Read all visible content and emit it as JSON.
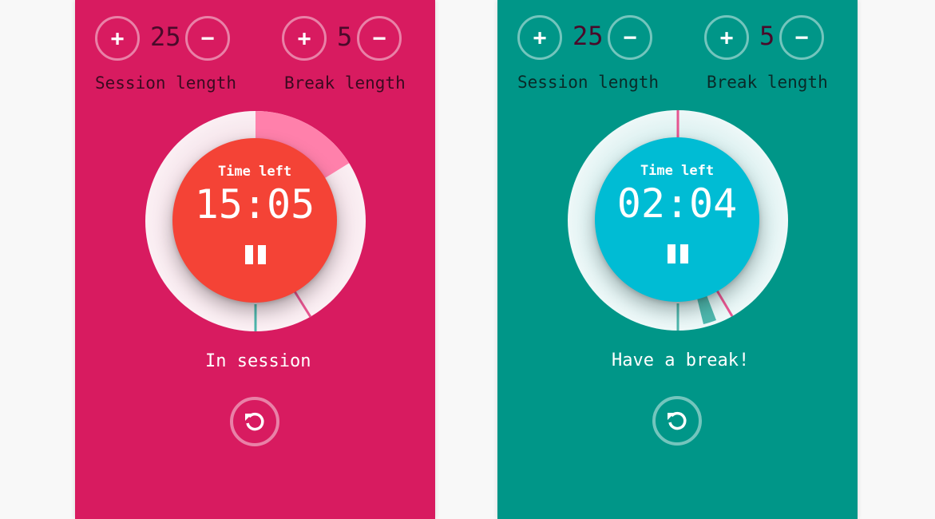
{
  "colors": {
    "session_panel_bg": "#d81b60",
    "break_panel_bg": "#009688",
    "session_inner": "#f44336",
    "break_inner": "#00bcd4",
    "progress_pink": "#ff80ab",
    "value_text": "#4a0025"
  },
  "icons": {
    "increase": "plus-icon",
    "decrease": "minus-icon",
    "pause": "pause-icon",
    "reset": "reset-icon"
  },
  "timers": [
    {
      "session_length": "25",
      "break_length": "5",
      "session_label": "Session length",
      "break_label": "Break length",
      "plus_label": "+",
      "minus_label": "−",
      "time_left_label": "Time left",
      "time": "15:05",
      "status": "In session",
      "progress_fraction": 0.2
    },
    {
      "session_length": "25",
      "break_length": "5",
      "session_label": "Session length",
      "break_label": "Break length",
      "plus_label": "+",
      "minus_label": "−",
      "time_left_label": "Time left",
      "time": "02:04",
      "status": "Have a break!",
      "progress_fraction": 0.58
    }
  ]
}
